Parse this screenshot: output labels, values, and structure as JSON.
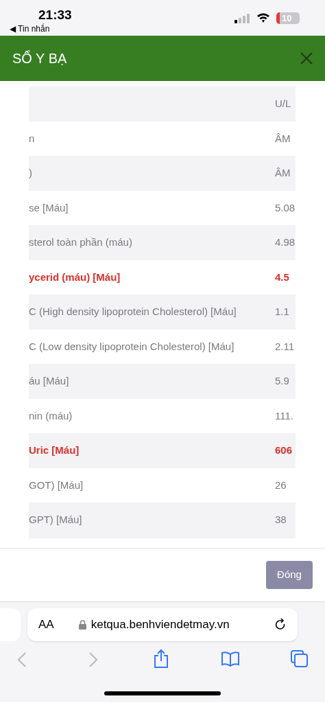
{
  "status_bar": {
    "time": "21:33",
    "back_label": "◀ Tin nhắn",
    "battery": "10"
  },
  "dialog": {
    "title": "SỔ Y BẠ",
    "close_button": "Đóng"
  },
  "table": {
    "rows": [
      {
        "test": "",
        "value": "U/L",
        "abnormal": false
      },
      {
        "test": "n",
        "value": "ÂM",
        "abnormal": false
      },
      {
        "test": ")",
        "value": "ÂM",
        "abnormal": false
      },
      {
        "test": "se [Máu]",
        "value": "5.08",
        "abnormal": false
      },
      {
        "test": "sterol toàn phần (máu)",
        "value": "4.98",
        "abnormal": false
      },
      {
        "test": "ycerid (máu) [Máu]",
        "value": "4.5",
        "abnormal": true
      },
      {
        "test": "C (High density lipoprotein Cholesterol) [Máu]",
        "value": "1.1",
        "abnormal": false
      },
      {
        "test": "C (Low density lipoprotein Cholesterol) [Máu]",
        "value": "2.11",
        "abnormal": false
      },
      {
        "test": "áu [Máu]",
        "value": "5.9",
        "abnormal": false
      },
      {
        "test": "nin (máu)",
        "value": "111.",
        "abnormal": false
      },
      {
        "test": "Uric [Máu]",
        "value": "606",
        "abnormal": true
      },
      {
        "test": "GOT) [Máu]",
        "value": "26",
        "abnormal": false
      },
      {
        "test": "GPT) [Máu]",
        "value": "38",
        "abnormal": false
      }
    ]
  },
  "browser": {
    "text_size_button": "AA",
    "url": "ketqua.benhviendetmay.vn"
  }
}
